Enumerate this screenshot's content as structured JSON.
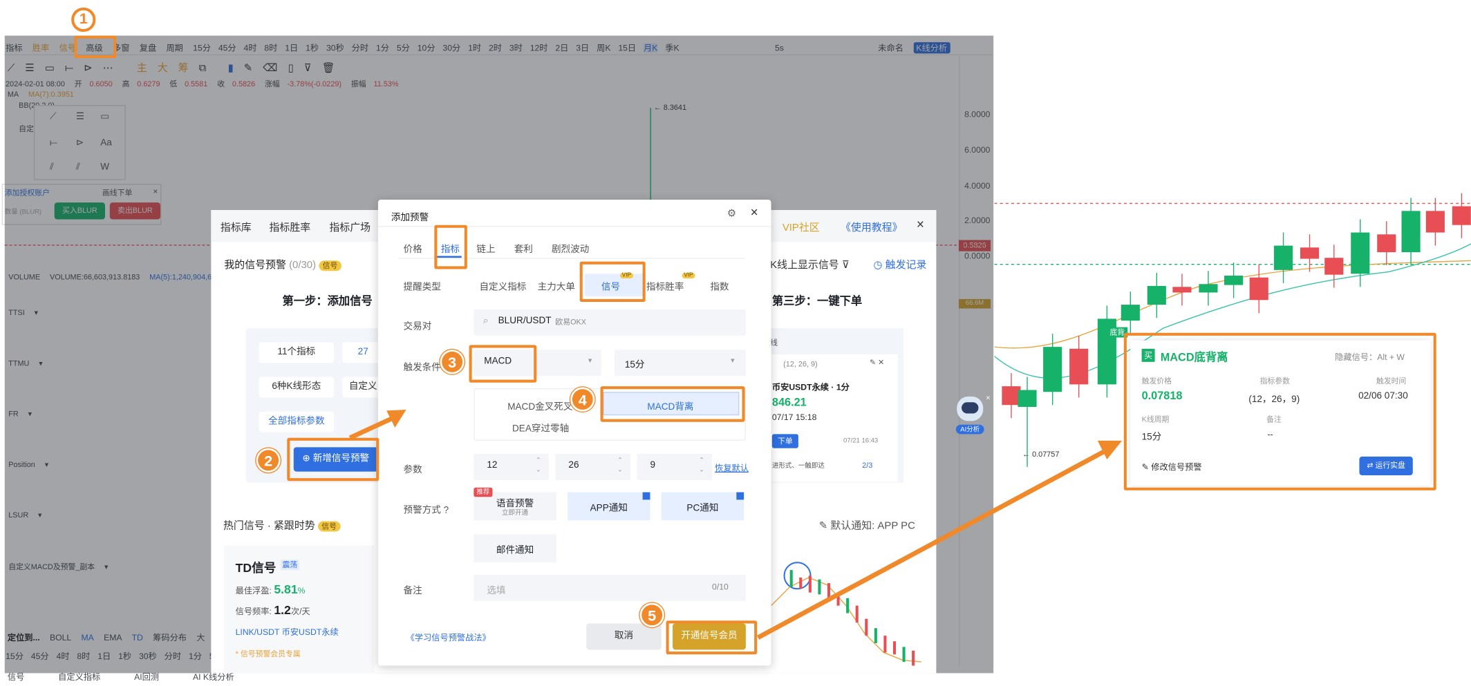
{
  "toolbar": {
    "left": [
      "指标",
      "胜率",
      "信号",
      "高级",
      "多窗",
      "复盘"
    ],
    "period_label": "周期",
    "periods": [
      "15分",
      "45分",
      "4时",
      "8时",
      "1日",
      "1秒",
      "30秒",
      "分时",
      "1分",
      "5分",
      "10分",
      "30分",
      "1时",
      "2时",
      "3时",
      "12时",
      "2日",
      "3日",
      "周K",
      "15日",
      "月K",
      "季K"
    ],
    "right_items": [
      "5s",
      "未命名",
      "K线分析"
    ],
    "draw_labels": [
      "主",
      "大",
      "筹"
    ]
  },
  "candle_info": {
    "date": "2024-02-01 08:00",
    "open_label": "开",
    "open": "0.6050",
    "high_label": "高",
    "high": "0.6279",
    "low_label": "低",
    "low": "0.5581",
    "close_label": "收",
    "close": "0.5826",
    "change_label": "涨幅",
    "change": "-3.78%(-0.0229)",
    "amp_label": "振幅",
    "amp": "11.53%"
  },
  "ma": {
    "label": "MA",
    "value": "MA(7):0.3951",
    "bb": "BB(20,2,0)",
    "others": [
      "自定"
    ]
  },
  "axis": {
    "prices": [
      "8.0000",
      "6.0000",
      "4.0000",
      "2.0000",
      "0.0000"
    ],
    "current": "0.5826",
    "peak": "8.3641",
    "vol_tag": "66.6M"
  },
  "volume": {
    "label": "VOLUME",
    "value": "VOLUME:66,603,913.8183",
    "ma": "MA(5):1,240,904,6"
  },
  "indicators": [
    "TTSI",
    "TTMU",
    "FR",
    "Position",
    "LSUR",
    "自定义MACD及预警_副本"
  ],
  "trade": {
    "auth": "添加授权账户",
    "limit": "画线下单",
    "qty": "数量 (BLUR)",
    "buy": "买入BLUR",
    "sell": "卖出BLUR"
  },
  "bottom": {
    "locate": "定位到...",
    "indicators": [
      "BOLL",
      "MA",
      "EMA",
      "TD",
      "筹码分布",
      "大"
    ],
    "periods": [
      "15分",
      "45分",
      "4时",
      "8时",
      "1日",
      "1秒",
      "30秒",
      "分时",
      "1分",
      "5分"
    ],
    "tabs": [
      "信号",
      "自定义指标",
      "AI回测",
      "AI K线分析"
    ]
  },
  "bg_dialog": {
    "tabs": [
      "指标库",
      "指标胜率",
      "指标广场"
    ],
    "vip": "VIP社区",
    "tutorial": "《使用教程》",
    "my_signal": "我的信号预警",
    "count": "(0/30)",
    "signal_tag": "信号",
    "step1": "第一步：添加信号",
    "step3": "第三步：一键下单",
    "kline_show": "K线上显示信号",
    "trigger_log": "触发记录",
    "chips": [
      "11个指标",
      "27",
      "6种K线形态",
      "自定义",
      "全部指标参数"
    ],
    "add_btn": "新增信号预警",
    "hot": "热门信号 · 紧跟时势",
    "default_notify": "默认通知: APP PC",
    "td": {
      "title": "TD信号",
      "tag": "震荡",
      "best": "最佳浮盈:",
      "best_val": "5.81",
      "pct": "%",
      "freq": "信号频率:",
      "freq_val": "1.2",
      "freq_unit": "次/天",
      "pair": "LINK/USDT 币安USDT永续",
      "vip_only": "* 信号预警会员专属"
    },
    "card": {
      "params": "(12, 26, 9)",
      "name": "币安USDT永续 · 1分",
      "price": "846.21",
      "time": "07/17 15:18",
      "order": "下单",
      "ts": "07/21 16:43",
      "form": "进形式、一触即达",
      "page": "2/3"
    },
    "macd_label": "线"
  },
  "dialog": {
    "title": "添加预警",
    "tabs": [
      "价格",
      "指标",
      "链上",
      "套利",
      "剧烈波动"
    ],
    "reminder_label": "提醒类型",
    "types": [
      "自定义指标",
      "主力大单",
      "信号",
      "指标胜率",
      "指数"
    ],
    "vip": "VIP",
    "pair_label": "交易对",
    "pair": "BLUR/USDT",
    "exchange": "欧易OKX",
    "trigger_label": "触发条件",
    "indicator": "MACD",
    "interval": "15分",
    "options": [
      "MACD金叉死叉",
      "MACD背离",
      "DEA穿过零轴"
    ],
    "param_label": "参数",
    "params": [
      "12",
      "26",
      "9"
    ],
    "restore": "恢复默认",
    "notify_label": "预警方式",
    "notify": [
      "语音预警",
      "APP通知",
      "PC通知",
      "邮件通知"
    ],
    "voice_sub": "立即开通",
    "recommend": "推荐",
    "remark_label": "备注",
    "remark_placeholder": "选填",
    "remark_count": "0/10",
    "learn": "《学习信号预警战法》",
    "cancel": "取消",
    "open_member": "开通信号会员"
  },
  "steps": [
    "1",
    "2",
    "3",
    "4",
    "5"
  ],
  "signal_card": {
    "buy": "买",
    "title": "MACD底背离",
    "hide": "隐藏信号：Alt + W",
    "trigger_price_label": "触发价格",
    "trigger_price": "0.07818",
    "param_label": "指标参数",
    "params": "(12，26，9)",
    "time_label": "触发时间",
    "time": "02/06 07:30",
    "period_label": "K线周期",
    "period": "15分",
    "remark_label": "备注",
    "remark": "--",
    "edit": "修改信号预警",
    "run": "运行实盘"
  },
  "right_chart": {
    "low": "0.07757",
    "badge": "底背"
  },
  "ai": "AI分析",
  "colors": {
    "accent": "#2f6fe0",
    "orange": "#f0892a",
    "green": "#17b26a",
    "red": "#e84f54",
    "gold": "#d6a32a"
  }
}
